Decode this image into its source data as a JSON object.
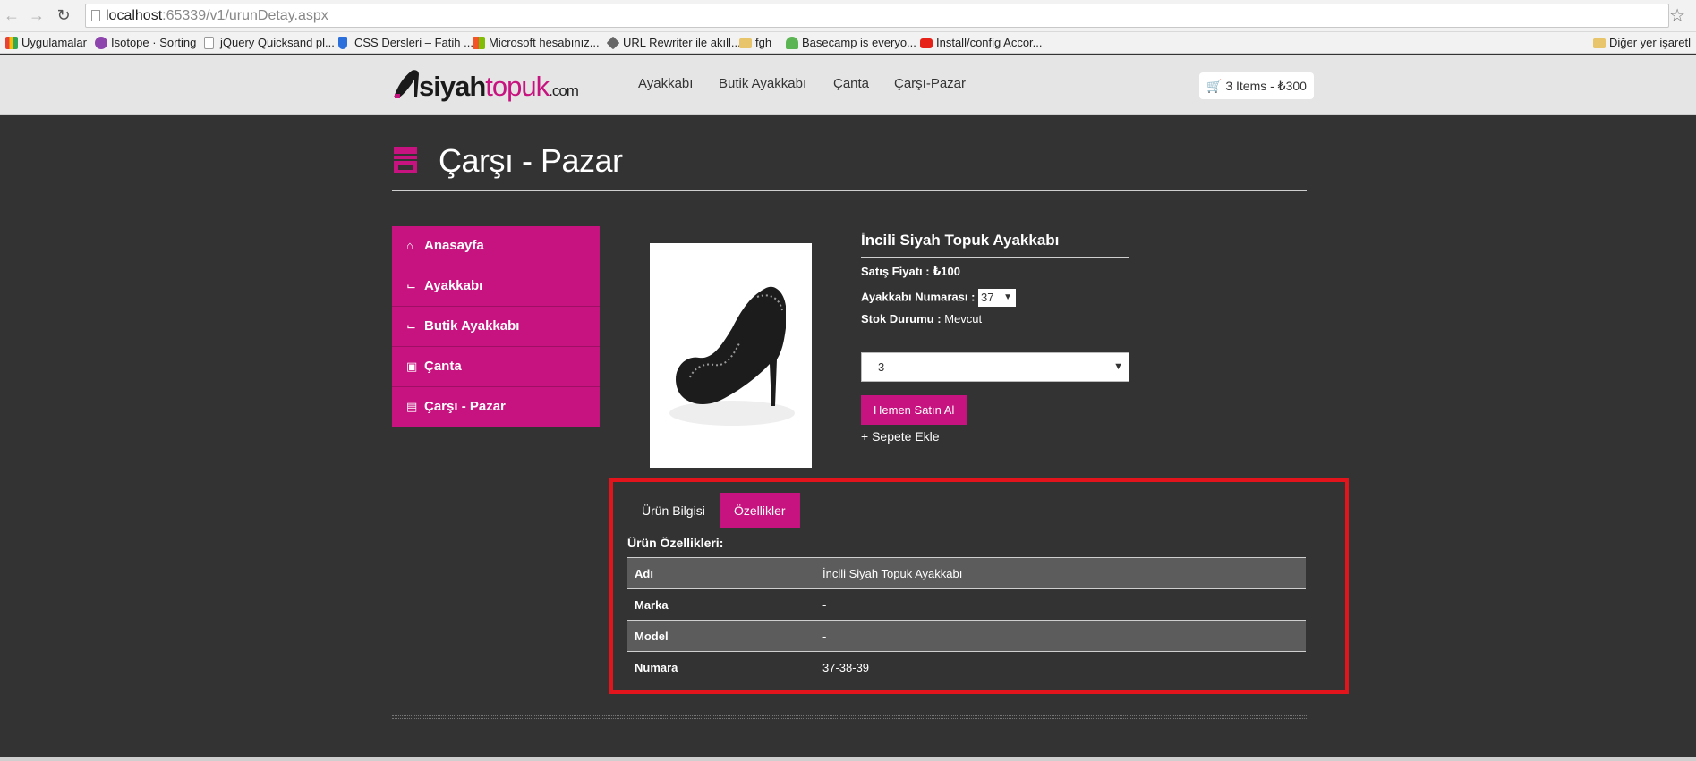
{
  "browser": {
    "url_host": "localhost",
    "url_rest": ":65339/v1/urunDetay.aspx",
    "bookmarks": [
      {
        "label": "Uygulamalar",
        "color": "#e94235"
      },
      {
        "label": "Isotope · Sorting",
        "color": "#8e44ad"
      },
      {
        "label": "jQuery Quicksand pl...",
        "color": "#ffffff"
      },
      {
        "label": "CSS Dersleri – Fatih ...",
        "color": "#2a6fdb"
      },
      {
        "label": "Microsoft hesabınız...",
        "color": "#f35325"
      },
      {
        "label": "URL Rewriter ile akıll...",
        "color": "#666666"
      },
      {
        "label": "fgh",
        "color": "#e8c56a"
      },
      {
        "label": "Basecamp is everyo...",
        "color": "#5ab552"
      },
      {
        "label": "Install/config Accor...",
        "color": "#e62117"
      }
    ],
    "other_bookmarks": "Diğer yer işaretl"
  },
  "header": {
    "logo_part1": "siyah",
    "logo_part2": "topuk",
    "logo_part3": ".com",
    "nav": [
      "Ayakkabı",
      "Butik Ayakkabı",
      "Çanta",
      "Çarşı-Pazar"
    ],
    "cart": "3 Items - ₺300"
  },
  "page": {
    "title": "Çarşı - Pazar"
  },
  "sidebar": {
    "items": [
      {
        "label": "Anasayfa",
        "icon": "home-icon"
      },
      {
        "label": "Ayakkabı",
        "icon": "shoe-icon"
      },
      {
        "label": "Butik Ayakkabı",
        "icon": "shoe-icon"
      },
      {
        "label": "Çanta",
        "icon": "bag-icon"
      },
      {
        "label": "Çarşı - Pazar",
        "icon": "store-icon"
      }
    ]
  },
  "product": {
    "name": "İncili Siyah Topuk Ayakkabı",
    "price_label": "Satış Fiyatı :",
    "price_value": "₺100",
    "size_label": "Ayakkabı Numarası :",
    "size_value": "37",
    "stock_label": "Stok Durumu :",
    "stock_value": "Mevcut",
    "quantity": "3",
    "buy_button": "Hemen Satın Al",
    "add_to_cart": "+ Sepete Ekle"
  },
  "tabs": {
    "items": [
      "Ürün Bilgisi",
      "Özellikler"
    ],
    "active": 1
  },
  "features": {
    "heading": "Ürün Özellikleri:",
    "rows": [
      {
        "key": "Adı",
        "value": "İncili Siyah Topuk Ayakkabı"
      },
      {
        "key": "Marka",
        "value": "-"
      },
      {
        "key": "Model",
        "value": "-"
      },
      {
        "key": "Numara",
        "value": "37-38-39"
      }
    ]
  },
  "colors": {
    "accent": "#c7137f",
    "background": "#333333",
    "highlight": "#e3141b"
  }
}
